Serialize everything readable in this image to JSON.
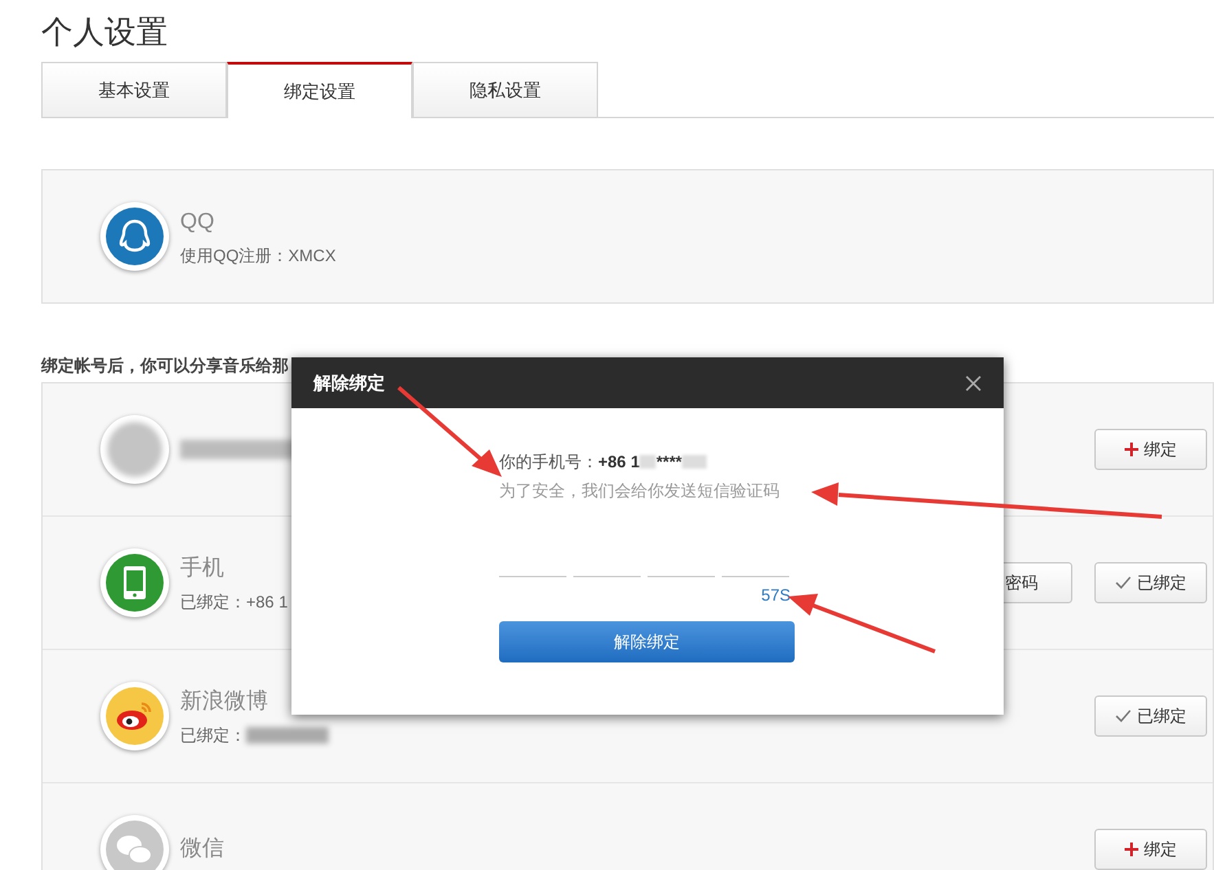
{
  "page_title": "个人设置",
  "tabs": [
    {
      "label": "基本设置",
      "selected": false
    },
    {
      "label": "绑定设置",
      "selected": true
    },
    {
      "label": "隐私设置",
      "selected": false
    }
  ],
  "qq_card": {
    "name": "QQ",
    "detail": "使用QQ注册：XMCX"
  },
  "note": "绑定帐号后，你可以分享音乐给那",
  "accounts": [
    {
      "kind": "blurred",
      "bound": false,
      "button": "绑定"
    },
    {
      "kind": "phone",
      "name": "手机",
      "detail": "已绑定：+86 1",
      "extra_button": "密码",
      "bound": true,
      "button": "已绑定"
    },
    {
      "kind": "weibo",
      "name": "新浪微博",
      "detail": "已绑定：",
      "bound": true,
      "button": "已绑定"
    },
    {
      "kind": "wechat",
      "name": "微信",
      "bound": false,
      "button": "绑定"
    }
  ],
  "dialog": {
    "title": "解除绑定",
    "phone_label": "你的手机号：",
    "phone_prefix": "+86 1",
    "phone_mask": "****",
    "hint": "为了安全，我们会给你发送短信验证码",
    "countdown": "57S",
    "submit": "解除绑定"
  }
}
